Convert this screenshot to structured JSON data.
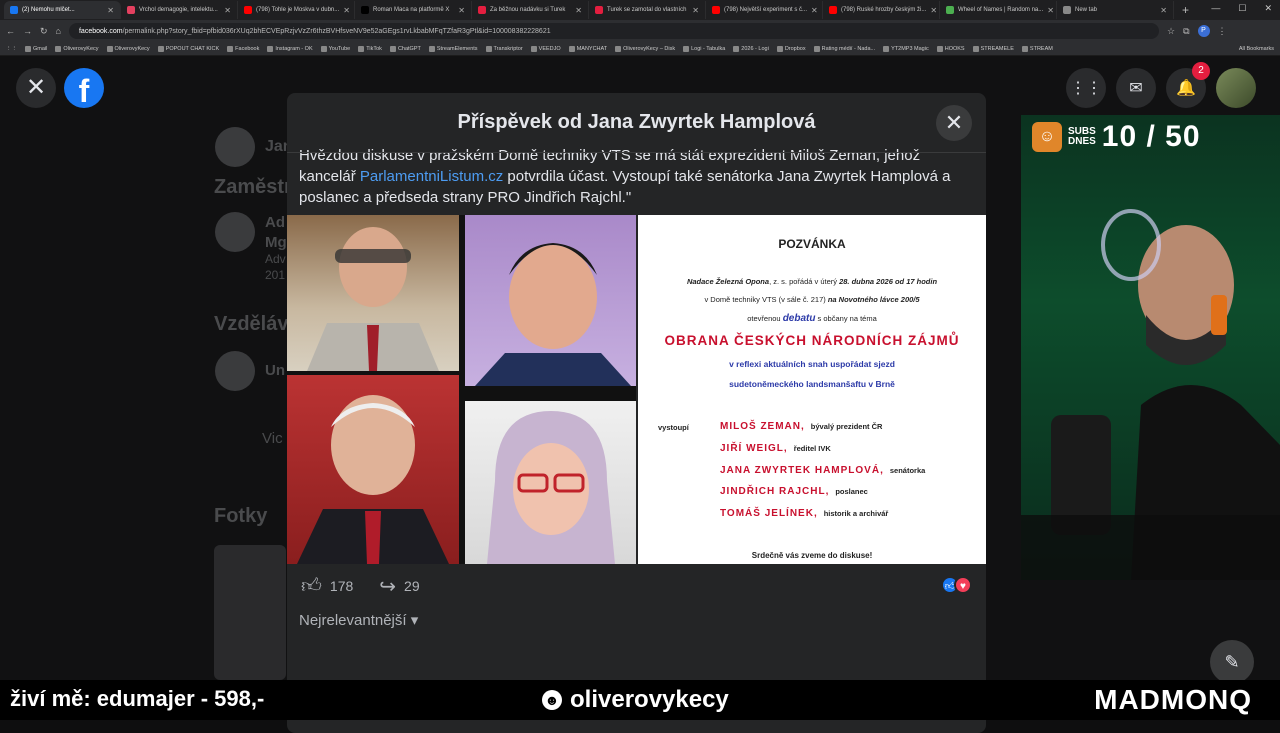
{
  "browser": {
    "tabs": [
      {
        "label": "(2) Nemohu mlčet...",
        "color": "#1877f2"
      },
      {
        "label": "Vrchol demagogie, intelektu...",
        "color": "#e4405f"
      },
      {
        "label": "(798) Tohle je Moskva v dubn...",
        "color": "#ff0000"
      },
      {
        "label": "Roman Maca na platformě X",
        "color": "#000000"
      },
      {
        "label": "Za běžnou nadávku si Turek",
        "color": "#e41e3f"
      },
      {
        "label": "Turek se zamotal do vlastních",
        "color": "#e41e3f"
      },
      {
        "label": "(798) Největší experiment s č...",
        "color": "#ff0000"
      },
      {
        "label": "(798) Ruské hrozby českým ži...",
        "color": "#ff0000"
      },
      {
        "label": "Wheel of Names | Random na...",
        "color": "#4caf50"
      },
      {
        "label": "New tab",
        "color": "#888888"
      }
    ],
    "url_host": "facebook.com",
    "url_path": "/permalink.php?story_fbid=pfbid036rXUq2bhECVEpRzjvVzZr6thzBVHfsveNV9e52aGEgs1rvLkbabMFqTZfaR3gPtl&id=100008382228621",
    "bookmarks": [
      "Gmail",
      "OliverovyKecy",
      "OliverovyKecy",
      "POPOUT CHAT KICK",
      "Facebook",
      "Instagram - OK",
      "YouTube",
      "TikTok",
      "ChatGPT",
      "StreamElements",
      "Transkriptor",
      "VEEDJO",
      "MANYCHAT",
      "OliverovyKecy – Disk",
      "Logi - Tabulka",
      "2026 - Logi",
      "Dropbox",
      "Rating médií - Nada...",
      "YT2MP3 Magic",
      "HOOKS",
      "STREAMELE",
      "STREAM"
    ],
    "all_bookmarks": "All Bookmarks"
  },
  "facebook": {
    "notifications_count": "2",
    "bg_labels": [
      "Jan",
      "Zaměstn",
      "Ad",
      "Mg",
      "Adv",
      "201",
      "Vzdělává",
      "Un",
      "Vic",
      "Fotky"
    ]
  },
  "modal": {
    "title": "Příspěvek od Jana Zwyrtek Hamplová",
    "text_part1": "Hvězdou diskuse v pražském Domě techniky VTS se má stát exprezident Miloš Zeman, jehož kancelář ",
    "text_link": "ParlamentniListum.cz",
    "text_part2": " potvrdila účast. Vystoupí také senátorka Jana Zwyrtek Hamplová a poslanec a předseda strany PRO Jindřich Rajchl.\"",
    "likes": "178",
    "shares": "29",
    "sort_label": "Nejrelevantnější"
  },
  "invitation": {
    "title": "POZVÁNKA",
    "line1_a": "Nadace Železná Opona",
    "line1_b": ", z. s. pořádá  v úterý ",
    "line1_c": "28. dubna 2026 od 17 hodin",
    "line2_a": "v Domě techniky VTS (v sále č. 217) ",
    "line2_b": "na Novotného lávce 200/5",
    "line3_a": "otevřenou ",
    "line3_b": "debatu",
    "line3_c": " s občany na téma",
    "topic": "OBRANA ČESKÝCH NÁRODNÍCH ZÁJMŮ",
    "sub1": "v reflexi aktuálních snah uspořádat sjezd",
    "sub2": "sudetoněmeckého landsmanšaftu v Brně",
    "speakers_label": "vystoupí",
    "speakers": [
      {
        "name": "MILOŠ  ZEMAN",
        "role": "bývalý prezident  ČR"
      },
      {
        "name": "JIŘÍ  WEIGL",
        "role": "ředitel  IVK"
      },
      {
        "name": "JANA  ZWYRTEK  HAMPLOVÁ",
        "role": "senátorka"
      },
      {
        "name": "JINDŘICH  RAJCHL",
        "role": "poslanec"
      },
      {
        "name": "TOMÁŠ  JELÍNEK",
        "role": "historik a archivář"
      }
    ],
    "closing": "Srdečně vás zveme do  diskuse!"
  },
  "stream": {
    "subs_label_1": "SUBS",
    "subs_label_2": "DNES",
    "subs_count": "10 / 50",
    "donation": "živí mě: edumajer - 598,-",
    "handle": "oliverovykecy",
    "brand": "MADMONQ"
  }
}
